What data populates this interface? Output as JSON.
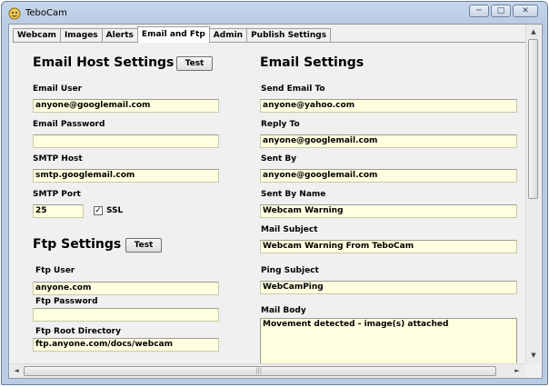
{
  "window": {
    "title": "TeboCam",
    "minimize": "─",
    "maximize": "□",
    "close": "✕"
  },
  "tabs": [
    {
      "label": "Webcam"
    },
    {
      "label": "Images"
    },
    {
      "label": "Alerts"
    },
    {
      "label": "Email and Ftp",
      "active": true
    },
    {
      "label": "Admin"
    },
    {
      "label": "Publish Settings"
    }
  ],
  "email_host": {
    "heading": "Email Host Settings",
    "test_label": "Test",
    "email_user_label": "Email User",
    "email_user": "anyone@googlemail.com",
    "email_password_label": "Email Password",
    "email_password": "",
    "smtp_host_label": "SMTP Host",
    "smtp_host": "smtp.googlemail.com",
    "smtp_port_label": "SMTP Port",
    "smtp_port": "25",
    "ssl_label": "SSL",
    "ssl_checked": true,
    "ssl_mark": "✓"
  },
  "ftp": {
    "heading": "Ftp Settings",
    "test_label": "Test",
    "user_label": "Ftp User",
    "user": "anyone.com",
    "password_label": "Ftp Password",
    "password": "",
    "root_label": "Ftp Root Directory",
    "root": "ftp.anyone.com/docs/webcam"
  },
  "email_settings": {
    "heading": "Email Settings",
    "send_to_label": "Send Email To",
    "send_to": "anyone@yahoo.com",
    "reply_to_label": "Reply To",
    "reply_to": "anyone@googlemail.com",
    "sent_by_label": "Sent By",
    "sent_by": "anyone@googlemail.com",
    "sent_by_name_label": "Sent By Name",
    "sent_by_name": "Webcam Warning",
    "mail_subject_label": "Mail Subject",
    "mail_subject": "Webcam Warning From TeboCam",
    "ping_subject_label": "Ping Subject",
    "ping_subject": "WebCamPing",
    "mail_body_label": "Mail Body",
    "mail_body": "Movement detected - image(s) attached"
  },
  "scroll": {
    "up": "▲",
    "down": "▼",
    "left": "◄",
    "right": "►",
    "grip": "|||"
  }
}
